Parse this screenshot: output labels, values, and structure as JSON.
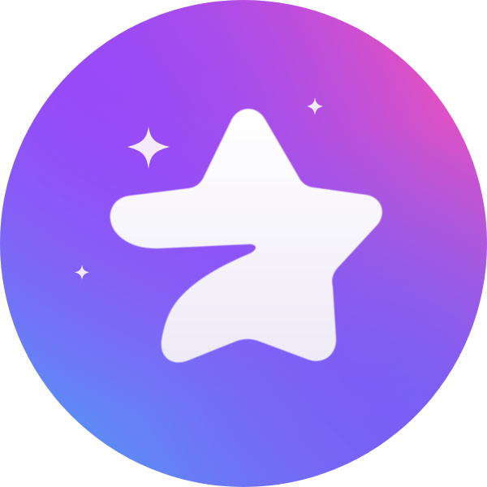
{
  "logo": {
    "icon": "premium-star-icon",
    "sparkle_icon": "sparkle-icon",
    "colors": {
      "gradient_top_left": "#9a47f9",
      "gradient_top_right": "#ff4fb1",
      "gradient_bottom_left": "#4a9ff8",
      "gradient_bottom_right": "#7a5bf5",
      "star": "#f6f4fb",
      "sparkle": "#f4eafc"
    }
  }
}
